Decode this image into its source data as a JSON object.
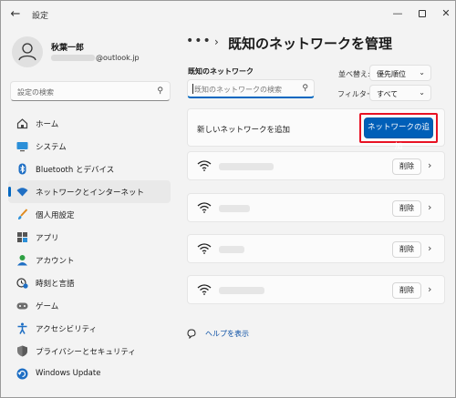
{
  "window": {
    "title": "設定",
    "back_glyph": "←"
  },
  "title_controls": {
    "minimize": "—",
    "close": "✕"
  },
  "user": {
    "name": "秋葉一郎",
    "email_suffix": "@outlook.jp"
  },
  "sidebar": {
    "search_placeholder": "設定の検索",
    "items": [
      {
        "label": "ホーム",
        "icon": "home-icon"
      },
      {
        "label": "システム",
        "icon": "system-icon"
      },
      {
        "label": "Bluetooth とデバイス",
        "icon": "bluetooth-icon"
      },
      {
        "label": "ネットワークとインターネット",
        "icon": "network-icon",
        "active": true
      },
      {
        "label": "個人用設定",
        "icon": "brush-icon"
      },
      {
        "label": "アプリ",
        "icon": "apps-icon"
      },
      {
        "label": "アカウント",
        "icon": "account-icon"
      },
      {
        "label": "時刻と言語",
        "icon": "time-language-icon"
      },
      {
        "label": "ゲーム",
        "icon": "game-icon"
      },
      {
        "label": "アクセシビリティ",
        "icon": "accessibility-icon"
      },
      {
        "label": "プライバシーとセキュリティ",
        "icon": "shield-icon"
      },
      {
        "label": "Windows Update",
        "icon": "update-icon"
      }
    ]
  },
  "breadcrumb": {
    "more": "•••",
    "separator": "›",
    "title": "既知のネットワークを管理"
  },
  "known": {
    "label": "既知のネットワーク",
    "search_placeholder": "既知のネットワークの検索",
    "sort_label": "並べ替え:",
    "sort_value": "優先順位",
    "filter_label": "フィルター:",
    "filter_value": "すべて"
  },
  "add_network": {
    "label": "新しいネットワークを追加",
    "button": "ネットワークの追加"
  },
  "networks": [
    {
      "delete_label": "削除"
    },
    {
      "delete_label": "削除"
    },
    {
      "delete_label": "削除"
    },
    {
      "delete_label": "削除"
    }
  ],
  "help": {
    "label": "ヘルプを表示"
  },
  "colors": {
    "accent": "#005fb8",
    "highlight": "#e81123"
  }
}
